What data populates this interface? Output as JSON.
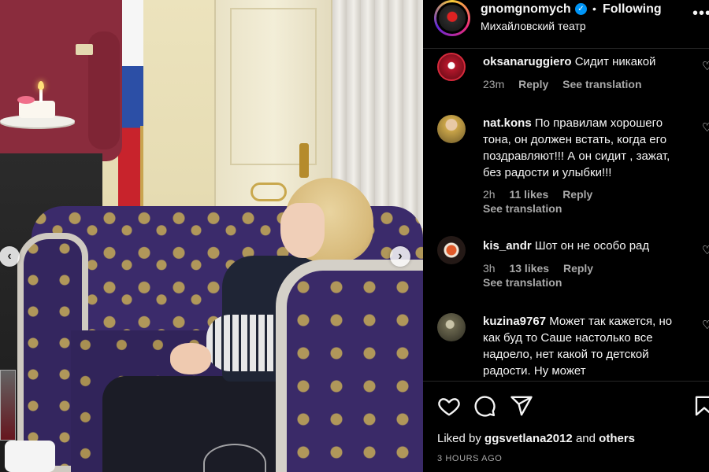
{
  "post": {
    "username": "gnomgnomych",
    "verified": true,
    "separator": "•",
    "follow_status": "Following",
    "location": "Михайловский театр",
    "more": "•••"
  },
  "carousel": {
    "prev": "‹",
    "next": "›"
  },
  "comments": [
    {
      "username": "oksanaruggiero",
      "text": "Сидит никакой",
      "time": "23m",
      "likes": "",
      "reply": "Reply",
      "translate": "See translation",
      "translate_inline": true,
      "avatar_color": "#a7162a"
    },
    {
      "username": "nat.kons",
      "text": "По правилам хорошего тона, он должен встать, когда его поздравляют!!! А он сидит , зажат, без радости и улыбки!!!",
      "time": "2h",
      "likes": "11 likes",
      "reply": "Reply",
      "translate": "See translation",
      "translate_inline": false,
      "avatar_color": "#7a6a3c"
    },
    {
      "username": "kis_andr",
      "text": "Шот он не особо рад",
      "time": "3h",
      "likes": "13 likes",
      "reply": "Reply",
      "translate": "See translation",
      "translate_inline": false,
      "avatar_color": "#3a2a22"
    },
    {
      "username": "kuzina9767",
      "text": "Может так кажется, но как буд то Саше настолько все надоело, нет какой то детской радости. Ну может",
      "time": "",
      "likes": "",
      "reply": "",
      "translate": "",
      "translate_inline": false,
      "avatar_color": "#5a5a44"
    }
  ],
  "actions": {
    "icons": [
      "heart-icon",
      "comment-icon",
      "share-icon",
      "bookmark-icon"
    ],
    "liked_by_prefix": "Liked by ",
    "liked_by_user": "ggsvetlana2012",
    "liked_by_mid": " and ",
    "liked_by_others": "others",
    "time_ago": "3 HOURS AGO"
  },
  "colors": {
    "background": "#000000",
    "text": "#f5f5f5",
    "secondary": "#a8a8a8",
    "verified": "#0095f6",
    "divider": "#262626"
  }
}
